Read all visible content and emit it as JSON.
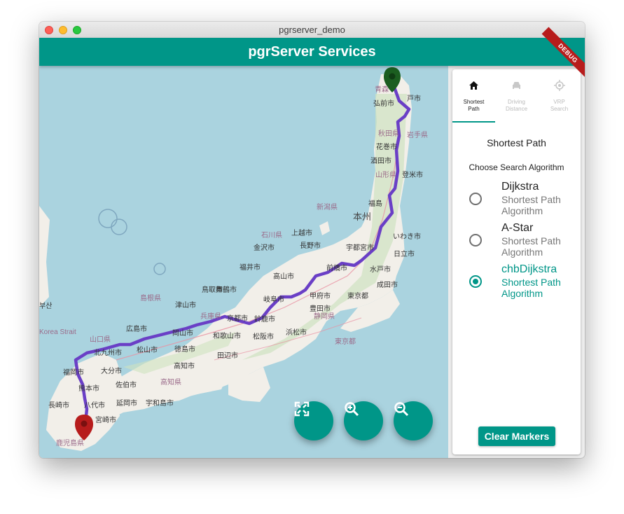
{
  "window": {
    "title": "pgrserver_demo"
  },
  "appbar": {
    "title": "pgrServer Services",
    "debug_banner": "DEBUG"
  },
  "map": {
    "labels": {
      "aomori": "青森",
      "hirosaki": "弘前市",
      "hachinohe": "戸市",
      "akita_pref": "秋田県",
      "iwate_pref": "岩手県",
      "hanamaki": "花巻市",
      "sakata": "酒田市",
      "yamagata_pref": "山形県",
      "tome": "登米市",
      "niigata_pref": "新潟県",
      "fukushima": "福島",
      "honshu": "本州",
      "iwaki": "いわき市",
      "ishikawa_pref": "石川県",
      "joetsu": "上越市",
      "nagano": "長野市",
      "utsunomiya": "宇都宮市",
      "hitachi": "日立市",
      "kanazawa": "金沢市",
      "fukui": "福井市",
      "maebashi": "前橋市",
      "mito": "水戸市",
      "tottori": "鳥取市",
      "maizuru": "舞鶴市",
      "takayama": "高山市",
      "narita": "成田市",
      "shimane_pref": "島根県",
      "tsuyama": "津山市",
      "gifu": "岐阜市",
      "kofu": "甲府市",
      "busan": "부산",
      "hyogo_pref": "兵庫県",
      "toyota": "豊田市",
      "tokyo": "東京都",
      "okayama": "岡山市",
      "kyoto": "京都市",
      "suzuka": "鈴鹿市",
      "shizuoka_pref": "静岡県",
      "hiroshima": "広島市",
      "wakayama": "和歌山市",
      "matsusaka": "松阪市",
      "hamamatsu": "浜松市",
      "yamaguchi_pref": "山口県",
      "kitakyushu": "北九州市",
      "matsuyama": "松山市",
      "tokushima": "徳島市",
      "tanabe": "田辺市",
      "tokyo_bay": "東京都",
      "korea_strait": "Korea Strait",
      "fukuoka": "福岡市",
      "oita": "大分市",
      "kochi": "高知市",
      "kumamoto": "熊本市",
      "saiki": "佐伯市",
      "kochi_pref": "高知県",
      "yatsushiro": "八代市",
      "nobeoka": "延岡市",
      "nagasaki": "長崎市",
      "uwajima": "宇和島市",
      "miyazaki": "宮崎市",
      "kagoshima_pref": "鹿児島県"
    }
  },
  "fabs": [
    {
      "icon": "fullscreen-icon"
    },
    {
      "icon": "zoom-in-icon"
    },
    {
      "icon": "zoom-out-icon"
    }
  ],
  "tabs": [
    {
      "icon": "home-icon",
      "label_line1": "Shortest",
      "label_line2": "Path"
    },
    {
      "icon": "car-icon",
      "label_line1": "Driving",
      "label_line2": "Distance"
    },
    {
      "icon": "gps-icon",
      "label_line1": "VRP",
      "label_line2": "Search"
    }
  ],
  "panel": {
    "section_title": "Shortest Path",
    "algorithm_prompt": "Choose Search Algorithm",
    "algorithms": [
      {
        "title": "Dijkstra",
        "subtitle": "Shortest Path Algorithm",
        "selected": false
      },
      {
        "title": "A-Star",
        "subtitle": "Shortest Path Algorithm",
        "selected": false
      },
      {
        "title": "chbDijkstra",
        "subtitle": "Shortest Path Algorithm",
        "selected": true
      }
    ],
    "clear_button": "Clear Markers"
  },
  "colors": {
    "primary": "#009688",
    "route": "#6a3fc6",
    "start_marker": "#1b5e20",
    "end_marker": "#b71c1c"
  }
}
